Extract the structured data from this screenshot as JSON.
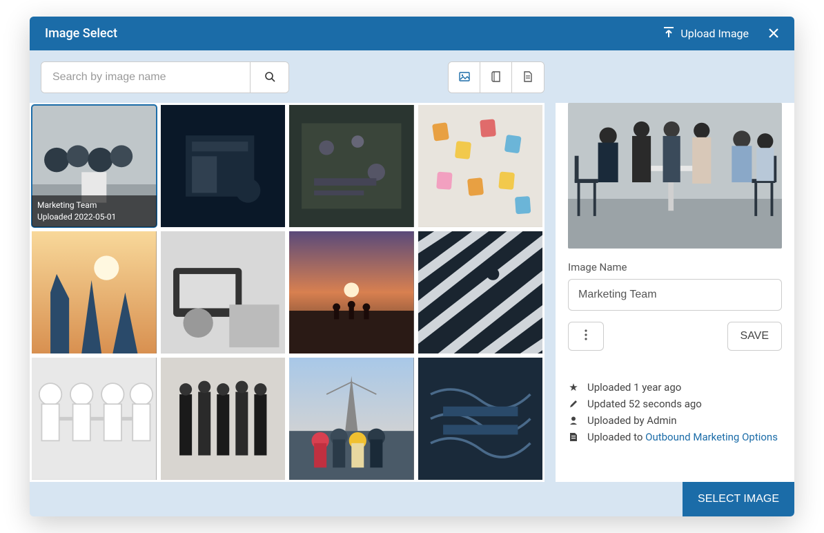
{
  "header": {
    "title": "Image Select",
    "upload_label": "Upload Image"
  },
  "search": {
    "placeholder": "Search by image name",
    "value": ""
  },
  "grid": {
    "selected_index": 0,
    "items": [
      {
        "name": "Marketing Team",
        "uploaded_line": "Uploaded 2022-05-01"
      },
      {
        "name": ""
      },
      {
        "name": ""
      },
      {
        "name": ""
      },
      {
        "name": ""
      },
      {
        "name": ""
      },
      {
        "name": ""
      },
      {
        "name": ""
      },
      {
        "name": ""
      },
      {
        "name": ""
      },
      {
        "name": ""
      },
      {
        "name": ""
      }
    ]
  },
  "sidebar": {
    "name_label": "Image Name",
    "name_value": "Marketing Team",
    "save_label": "SAVE",
    "meta": {
      "uploaded": "Uploaded 1 year ago",
      "updated": "Updated 52 seconds ago",
      "by": "Uploaded by Admin",
      "to_prefix": "Uploaded to ",
      "to_link": "Outbound Marketing Options"
    }
  },
  "footer": {
    "select_label": "SELECT IMAGE"
  }
}
